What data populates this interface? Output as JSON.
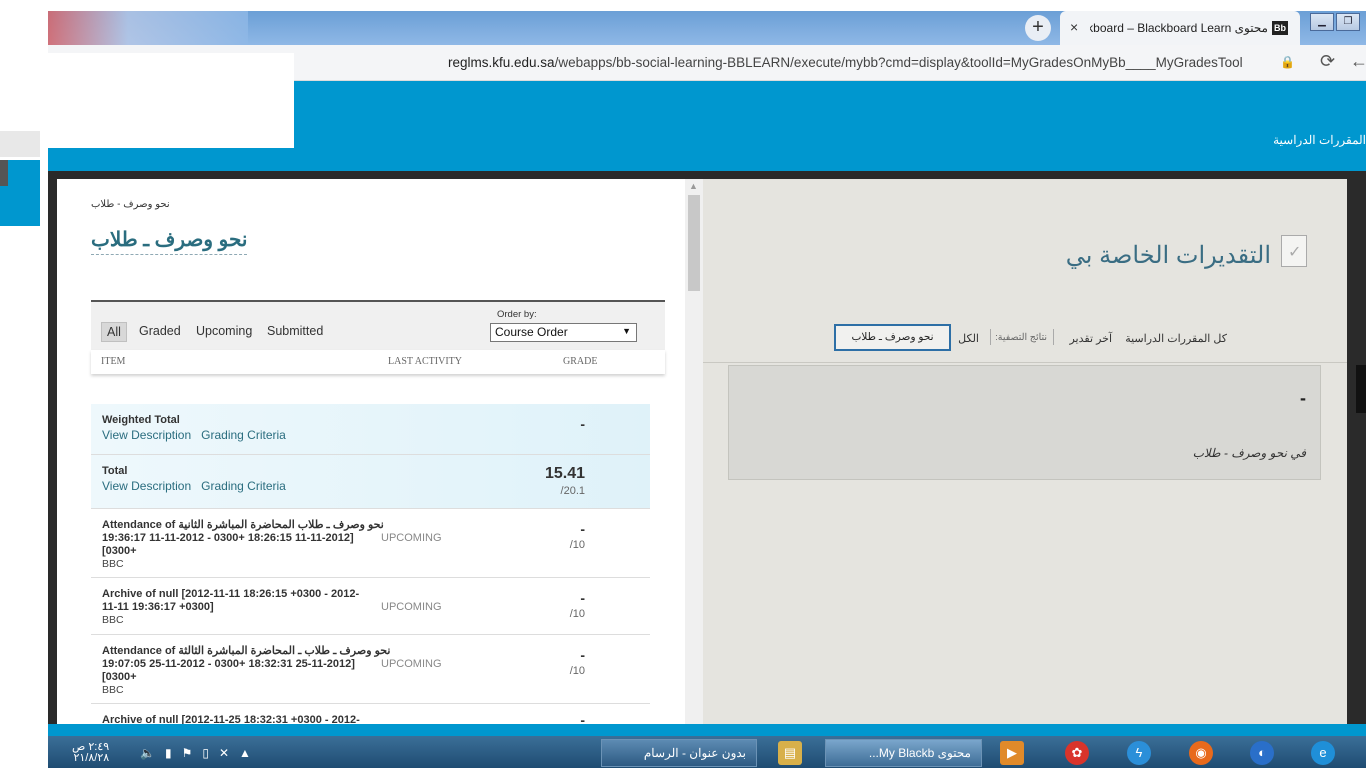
{
  "browser": {
    "tab_title": "محتوى kboard – Blackboard Learn",
    "tab_logo": "Bb",
    "new_tab_icon": "+",
    "close_icon": "×",
    "url": "reglms.kfu.edu.sa/webapps/bb-social-learning-BBLEARN/execute/mybb?cmd=display&toolId=MyGradesOnMyBb____MyGradesTool",
    "url_host": "reglms.kfu.edu.sa",
    "url_path": "/webapps/bb-social-learning-BBLEARN/execute/mybb?cmd=display&toolId=MyGradesOnMyBb____MyGradesTool"
  },
  "header": {
    "courses_link": "المقررات الدراسية"
  },
  "course": {
    "breadcrumb": "نحو وصرف - طلاب",
    "title": "نحو وصرف ـ طلاب"
  },
  "filters": {
    "tabs": [
      "All",
      "Graded",
      "Upcoming",
      "Submitted"
    ],
    "active": "All",
    "order_label": "Order by:",
    "order_value": "Course Order"
  },
  "columns": {
    "item": "ITEM",
    "last_activity": "LAST ACTIVITY",
    "grade": "GRADE"
  },
  "rows": [
    {
      "name": "Weighted Total",
      "links": [
        "View Description",
        "Grading Criteria"
      ],
      "grade": "-",
      "outof": ""
    },
    {
      "name": "Total",
      "links": [
        "View Description",
        "Grading Criteria"
      ],
      "grade": "15.41",
      "outof": "/20.1"
    },
    {
      "name_line1": "Attendance of نحو وصرف ـ طلاب المحاضرة المباشرة الثانية",
      "name_line2": "19:36:17 11-11-2012 - 0300+ 18:26:15 11-11-2012]",
      "name_line3": "[0300+",
      "sub": "BBC",
      "status": "UPCOMING",
      "grade": "-",
      "outof": "/10"
    },
    {
      "name_line1": "Archive of null [2012-11-11 18:26:15 +0300 - 2012-",
      "name_line2": "11-11 19:36:17 +0300]",
      "sub": "BBC",
      "status": "UPCOMING",
      "grade": "-",
      "outof": "/10"
    },
    {
      "name_line1": "Attendance of نحو وصرف ـ طلاب ـ المحاضرة المباشرة الثالثة",
      "name_line2": "19:07:05 25-11-2012 - 0300+ 18:32:31 25-11-2012]",
      "name_line3": "[0300+",
      "sub": "BBC",
      "status": "UPCOMING",
      "grade": "-",
      "outof": "/10"
    },
    {
      "name_line1": "Archive of null [2012-11-25 18:32:31 +0300 - 2012-",
      "grade": "-"
    }
  ],
  "right": {
    "page_title": "التقديرات الخاصة بي",
    "nav": {
      "all_courses": "كل المقررات الدراسية",
      "last_grade": "آخر تقدير",
      "filter_results": "نتائج التصفية:",
      "all": "الكل",
      "selected_course": "نحو وصرف ـ طلاب"
    },
    "card": {
      "grade": "-",
      "in_course": "في نحو وصرف - طلاب"
    }
  },
  "taskbar": {
    "time": "٢:٤٩ ص",
    "date": "٢١/٨/٢٨",
    "paint_button": "بدون عنوان - الرسام",
    "chrome_button": "محتوى My Blackb..."
  },
  "colors": {
    "bb_blue": "#0097cf",
    "link_teal": "#2a6d7f",
    "title_blue": "#3a6d83",
    "chip_border": "#2d6fa6"
  },
  "icons": [
    "close-icon",
    "plus-icon",
    "lock-icon",
    "reload-icon",
    "back-icon",
    "document-check-icon",
    "dropdown-arrow-icon",
    "scroll-up-icon"
  ]
}
